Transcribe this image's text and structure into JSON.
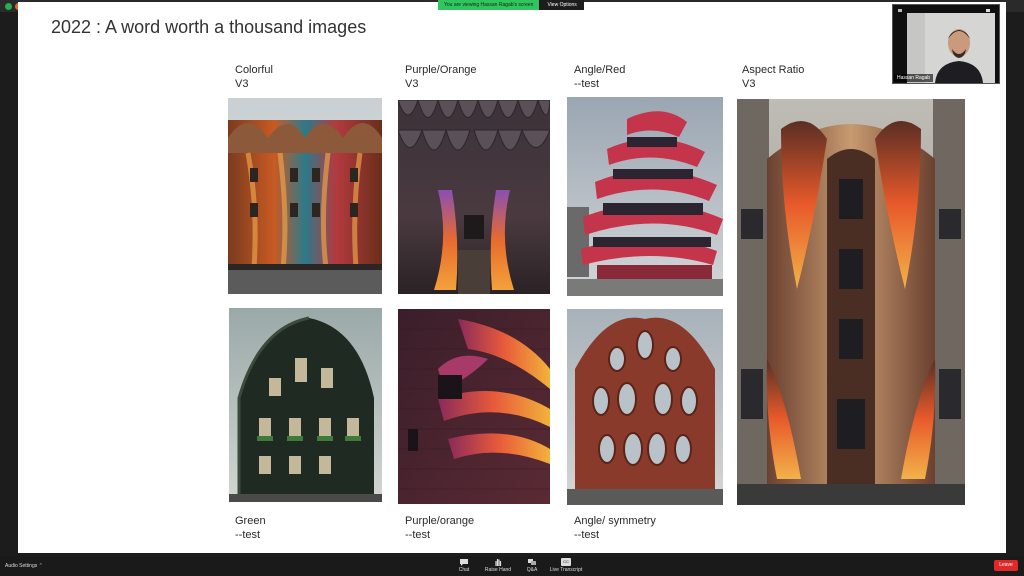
{
  "window": {
    "share_message": "You are viewing Hassan Ragab's screen",
    "view_options": "View Options"
  },
  "slide": {
    "title": "2022 : A word worth a thousand images",
    "captions": [
      {
        "text": "Colorful\nV3"
      },
      {
        "text": "Purple/Orange\nV3"
      },
      {
        "text": "Angle/Red\n--test"
      },
      {
        "text": "Aspect Ratio\nV3"
      },
      {
        "text": "Green\n--test"
      },
      {
        "text": "Purple/orange\n--test"
      },
      {
        "text": "Angle/ symmetry\n--test"
      }
    ]
  },
  "participant": {
    "name": "Hassan Ragab"
  },
  "toolbar": {
    "audio_settings": "Audio Settings",
    "chat": "Chat",
    "raise_hand": "Raise Hand",
    "qa": "Q&A",
    "live_transcript": "Live Transcript",
    "cc": "CC",
    "leave": "Leave"
  },
  "colors": {
    "zoom_green": "#31c45f",
    "leave_red": "#e02828"
  }
}
